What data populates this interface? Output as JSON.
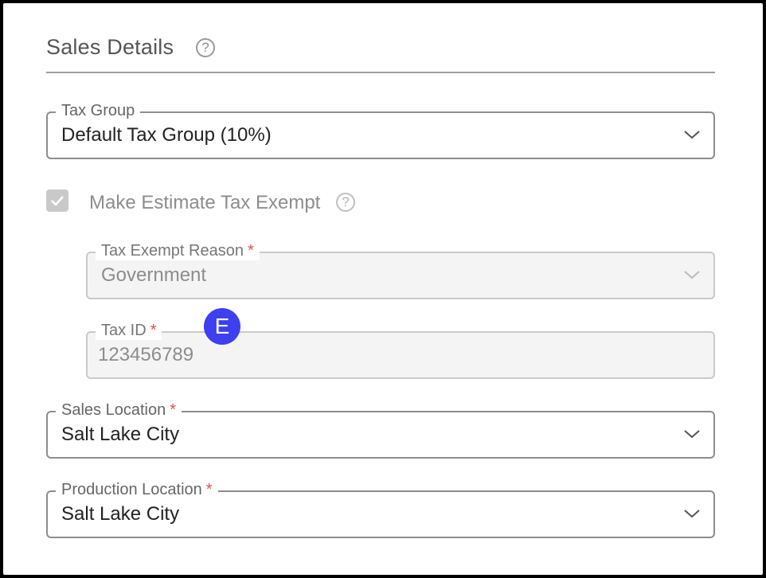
{
  "section": {
    "title": "Sales Details"
  },
  "icons": {
    "help": "?"
  },
  "tax_group": {
    "label": "Tax Group",
    "value": "Default Tax Group  (10%)"
  },
  "tax_exempt": {
    "label": "Make Estimate Tax Exempt",
    "checked": true
  },
  "tax_exempt_reason": {
    "label": "Tax Exempt Reason",
    "required_mark": "*",
    "value": "Government"
  },
  "tax_id": {
    "label": "Tax ID",
    "required_mark": "*",
    "value": "123456789"
  },
  "badge": {
    "text": "E",
    "color": "#3d3ff0"
  },
  "sales_location": {
    "label": "Sales Location",
    "required_mark": "*",
    "value": "Salt Lake City"
  },
  "production_location": {
    "label": "Production Location",
    "required_mark": "*",
    "value": "Salt Lake City"
  },
  "colors": {
    "required": "#d9534f",
    "border": "#8d8d8d",
    "disabled_bg": "#f4f4f4"
  }
}
